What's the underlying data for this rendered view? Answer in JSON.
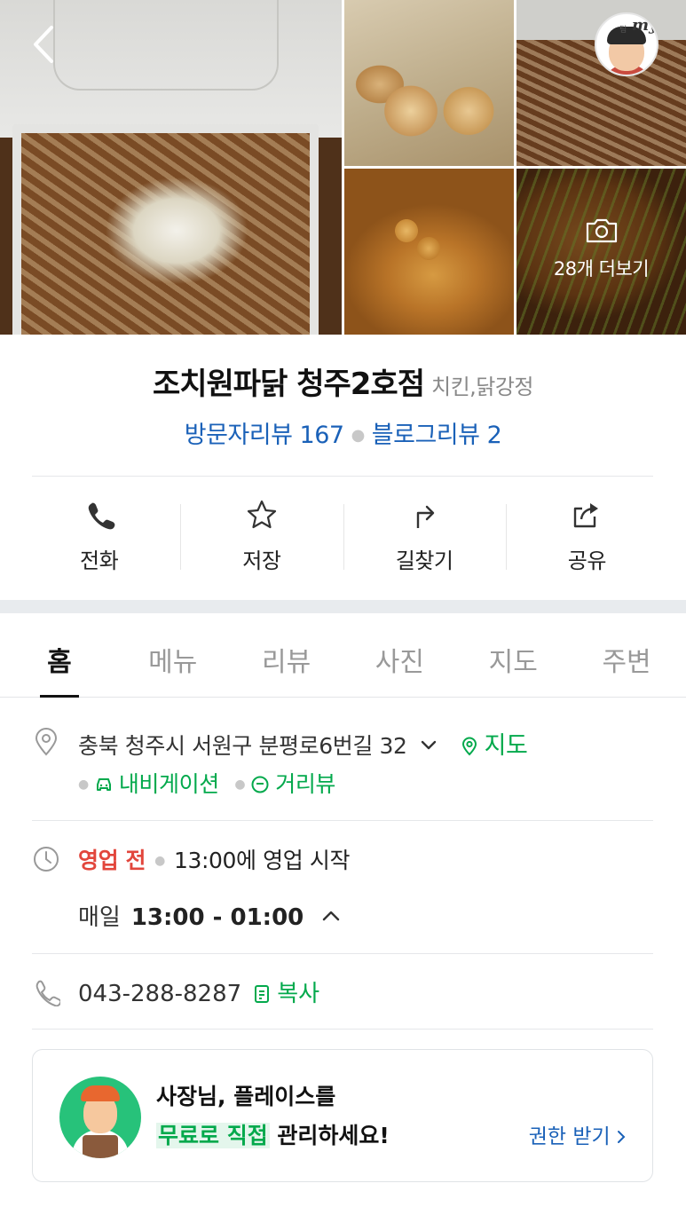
{
  "photos": {
    "more_label": "28개 더보기",
    "tiles": [
      "main-photo",
      "photo-2",
      "photo-3",
      "photo-4",
      "photo-5"
    ]
  },
  "header": {
    "avatar_badge": "my",
    "avatar_badge_prefix": "팀"
  },
  "place": {
    "name": "조치원파닭 청주2호점",
    "category": "치킨,닭강정",
    "visitor_review": "방문자리뷰 167",
    "blog_review": "블로그리뷰 2"
  },
  "actions": [
    {
      "label": "전화",
      "icon": "phone-icon"
    },
    {
      "label": "저장",
      "icon": "star-icon"
    },
    {
      "label": "길찾기",
      "icon": "directions-icon"
    },
    {
      "label": "공유",
      "icon": "share-icon"
    }
  ],
  "tabs": [
    {
      "label": "홈",
      "active": true
    },
    {
      "label": "메뉴",
      "active": false
    },
    {
      "label": "리뷰",
      "active": false
    },
    {
      "label": "사진",
      "active": false
    },
    {
      "label": "지도",
      "active": false
    },
    {
      "label": "주변",
      "active": false
    }
  ],
  "info": {
    "address": "충북 청주시 서원구 분평로6번길 32",
    "map_link": "지도",
    "navigation_link": "내비게이션",
    "street_view_link": "거리뷰",
    "status": "영업 전",
    "status_detail": "13:00에 영업 시작",
    "daily_label": "매일",
    "daily_hours": "13:00 - 01:00",
    "phone": "043-288-8287",
    "copy_label": "복사"
  },
  "banner": {
    "line1": "사장님, 플레이스를",
    "line2_highlight": "무료로 직접",
    "line2_rest": " 관리하세요!",
    "cta": "권한 받기"
  },
  "colors": {
    "link_blue": "#1a61b8",
    "accent_green": "#03a94c",
    "status_red": "#e2463c",
    "divider_band": "#e8ebee"
  }
}
